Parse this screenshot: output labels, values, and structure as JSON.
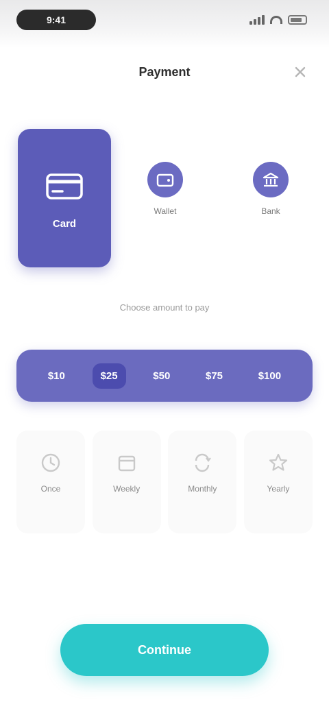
{
  "status_bar": {
    "time": "9:41"
  },
  "header": {
    "title": "Payment"
  },
  "methods": {
    "selected": {
      "label": "Card",
      "icon": "card-icon"
    },
    "options": [
      {
        "label": "Wallet",
        "icon": "wallet-icon"
      },
      {
        "label": "Bank",
        "icon": "bank-icon"
      }
    ]
  },
  "prompt": "Choose amount to pay",
  "segments": [
    "$10",
    "$25",
    "$50",
    "$75",
    "$100"
  ],
  "choices": [
    {
      "label": "Once",
      "icon": "clock-icon"
    },
    {
      "label": "Weekly",
      "icon": "calendar-icon"
    },
    {
      "label": "Monthly",
      "icon": "repeat-icon"
    },
    {
      "label": "Yearly",
      "icon": "star-icon"
    }
  ],
  "cta": {
    "label": "Continue"
  },
  "colors": {
    "primary": "#5c5cb8",
    "accent": "#2bc7c9",
    "background": "#ffffff"
  }
}
